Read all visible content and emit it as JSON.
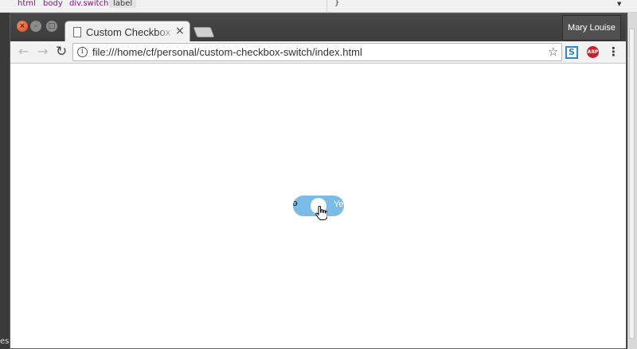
{
  "devtools": {
    "crumbs": [
      "html",
      "body",
      "div.switch",
      "label"
    ],
    "brace": "}",
    "edge_text": "es"
  },
  "window": {
    "profile_name": "Mary Louise"
  },
  "tab": {
    "title": "Custom Checkbox Switch",
    "close": "×"
  },
  "toolbar": {
    "back": "←",
    "forward": "→",
    "reload": "↻",
    "info": "i",
    "url": "file:///home/cf/personal/custom-checkbox-switch/index.html",
    "star": "☆",
    "ext_s": "S",
    "ext_abp": "ABP",
    "menu": "⋮"
  },
  "switch": {
    "off_label": "o",
    "on_label": "Ye",
    "checked": true,
    "color": "#7bbce6"
  }
}
